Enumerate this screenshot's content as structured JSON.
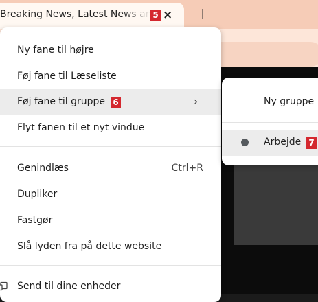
{
  "tab": {
    "title": "Breaking News, Latest News and Videos",
    "close_icon": "×",
    "badge": "5"
  },
  "new_tab_icon": "+",
  "context_menu": {
    "items": [
      {
        "label": "Ny fane til højre"
      },
      {
        "label": "Føj fane til Læseliste"
      },
      {
        "label": "Føj fane til gruppe",
        "badge": "6",
        "chevron": "›"
      },
      {
        "label": "Flyt fanen til et nyt vindue"
      },
      {
        "label": "Genindlæs",
        "shortcut": "Ctrl+R"
      },
      {
        "label": "Dupliker"
      },
      {
        "label": "Fastgør"
      },
      {
        "label": "Slå lyden fra på dette website"
      },
      {
        "label": "Send til dine enheder",
        "icon": "devices-icon"
      }
    ]
  },
  "submenu": {
    "new_group": "Ny gruppe",
    "groups": [
      {
        "label": "Arbejde",
        "badge": "7",
        "color": "#555a5e"
      }
    ]
  },
  "colors": {
    "badge": "#d4282f",
    "tabstrip": "#f6ccb7",
    "toolbar": "#fde6d9",
    "hover": "#ececec"
  }
}
